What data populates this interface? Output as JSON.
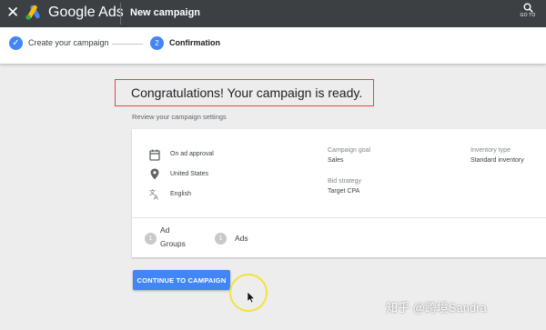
{
  "topbar": {
    "brand": "Google Ads",
    "page_name": "New campaign",
    "goto_label": "GO TO"
  },
  "stepper": {
    "step1_label": "Create your campaign",
    "step2_number": "2",
    "step2_label": "Confirmation"
  },
  "main": {
    "heading": "Congratulations! Your campaign is ready.",
    "subheading": "Review your campaign settings"
  },
  "summary": {
    "schedule": "On ad approval",
    "location": "United States",
    "language": "English",
    "campaign_goal_label": "Campaign goal",
    "campaign_goal_value": "Sales",
    "bid_strategy_label": "Bid strategy",
    "bid_strategy_value": "Target CPA",
    "inventory_type_label": "Inventory type",
    "inventory_type_value": "Standard inventory",
    "ad_groups_count": "1",
    "ad_groups_label_line1": "Ad",
    "ad_groups_label_line2": "Groups",
    "ads_count": "1",
    "ads_label": "Ads"
  },
  "actions": {
    "continue_label": "CONTINUE TO CAMPAIGN"
  },
  "watermark": "知乎 @跨境Sandra",
  "colors": {
    "topbar": "#3c4043",
    "accent": "#4285f4",
    "highlight_box": "#e0484b",
    "click_ring": "#f3e33b"
  }
}
